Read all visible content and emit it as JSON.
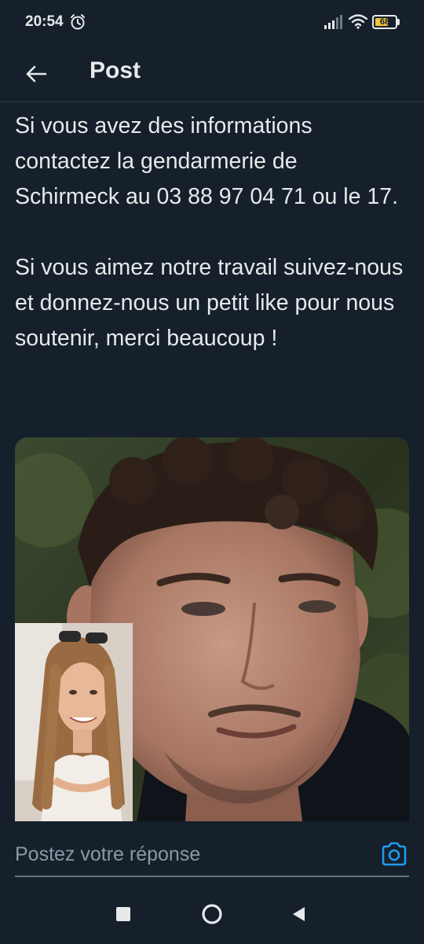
{
  "status_bar": {
    "time": "20:54",
    "battery_level": "68",
    "battery_fraction": 0.68,
    "icons": [
      "alarm-icon",
      "signal-icon",
      "wifi-icon",
      "battery-icon"
    ]
  },
  "header": {
    "title": "Post",
    "back_icon": "arrow-left-icon"
  },
  "post": {
    "paragraphs": [
      "Si vous avez des informations contactez la gendarmerie de Schirmeck au 03 88 97 04 71 ou le 17.",
      "Si vous aimez notre travail suivez-nous et donnez-nous un petit like pour nous soutenir, merci beaucoup !"
    ]
  },
  "reply": {
    "placeholder": "Postez votre réponse",
    "camera_icon": "camera-icon"
  },
  "nav": {
    "icons": [
      "recents-square-icon",
      "home-circle-icon",
      "back-triangle-icon"
    ]
  },
  "colors": {
    "background": "#15202b",
    "text": "#e7e9ea",
    "muted": "#8b98a5",
    "accent": "#1d9bf0",
    "battery": "#f0c33c"
  }
}
